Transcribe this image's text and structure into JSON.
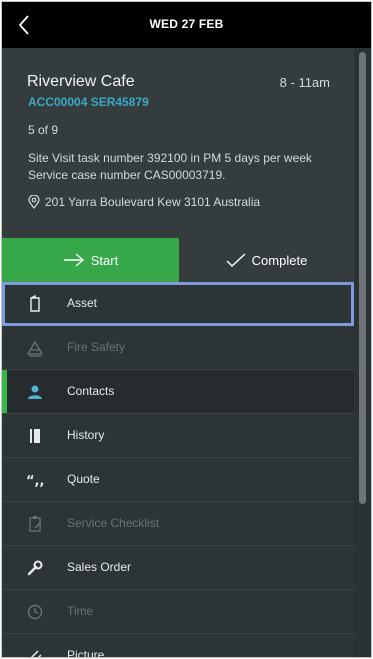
{
  "topbar": {
    "date": "WED 27 FEB"
  },
  "job": {
    "title": "Riverview Cafe",
    "time": "8 - 11am",
    "refs": "ACC00004 SER45879",
    "counter": "5 of 9",
    "description": "Site Visit task number 392100 in PM 5 days per week Service case number CAS00003719.",
    "address": "201 Yarra Boulevard Kew 3101 Australia"
  },
  "actions": {
    "start": "Start",
    "complete": "Complete"
  },
  "colors": {
    "accent_green": "#37a84a",
    "link_blue": "#3aa9c6",
    "selection": "#7f9be0"
  },
  "menu": [
    {
      "label": "Asset",
      "icon": "asset-icon",
      "state": "selected"
    },
    {
      "label": "Fire Safety",
      "icon": "fire-safety-icon",
      "state": "disabled"
    },
    {
      "label": "Contacts",
      "icon": "contact-icon",
      "state": "active"
    },
    {
      "label": "History",
      "icon": "history-icon",
      "state": "normal"
    },
    {
      "label": "Quote",
      "icon": "quote-icon",
      "state": "normal"
    },
    {
      "label": "Service Checklist",
      "icon": "checklist-icon",
      "state": "disabled"
    },
    {
      "label": "Sales Order",
      "icon": "wrench-icon",
      "state": "normal"
    },
    {
      "label": "Time",
      "icon": "clock-icon",
      "state": "disabled"
    },
    {
      "label": "Picture",
      "icon": "paperclip-icon",
      "state": "normal"
    }
  ]
}
